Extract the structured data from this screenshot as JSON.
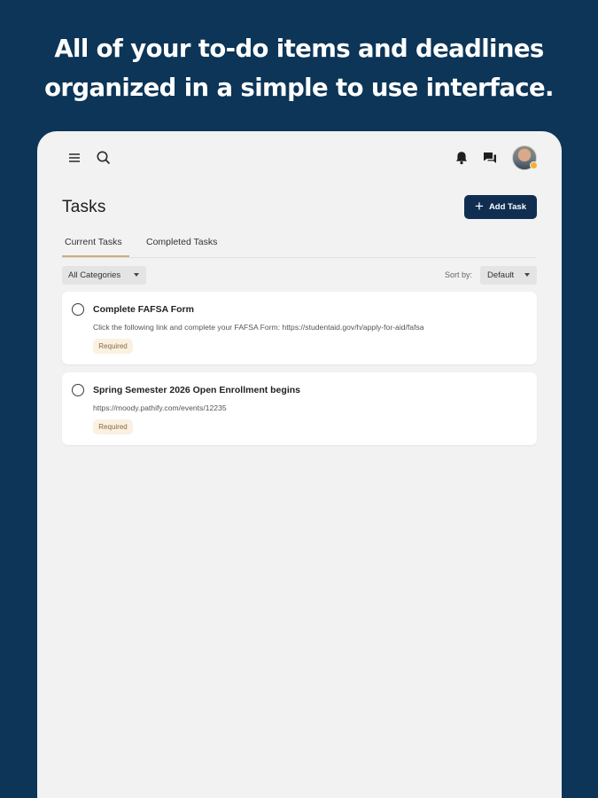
{
  "promo": {
    "line1": "All of your to-do items and deadlines",
    "line2": "organized in a simple to use interface."
  },
  "colors": {
    "background": "#0c3557",
    "primary_button": "#0f2e52",
    "tab_underline": "#c9b07a",
    "badge_bg": "#fbf1e2"
  },
  "topbar": {
    "icons": [
      "menu-icon",
      "search-icon",
      "bell-icon",
      "chat-icon"
    ]
  },
  "page": {
    "title": "Tasks",
    "add_button_label": "Add Task"
  },
  "tabs": [
    {
      "label": "Current Tasks",
      "active": true
    },
    {
      "label": "Completed Tasks",
      "active": false
    }
  ],
  "filters": {
    "category_selected": "All Categories",
    "sort_label": "Sort by:",
    "sort_selected": "Default"
  },
  "tasks": [
    {
      "title": "Complete FAFSA Form",
      "description": "Click the following link and complete your FAFSA Form: https://studentaid.gov/h/apply-for-aid/fafsa",
      "badge": "Required"
    },
    {
      "title": "Spring Semester 2026 Open Enrollment begins",
      "description": "https://moody.pathify.com/events/12235",
      "badge": "Required"
    }
  ]
}
